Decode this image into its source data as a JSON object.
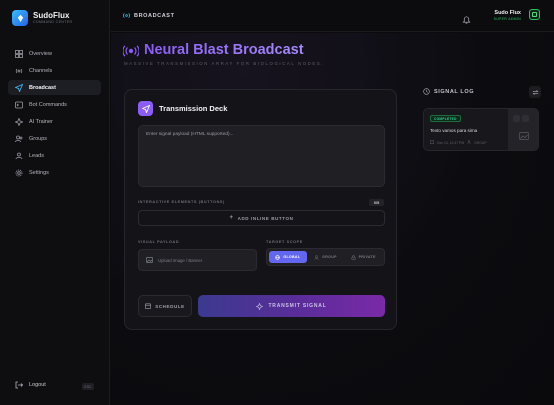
{
  "brand": {
    "name": "SudoFlux",
    "tagline": "COMMAND CENTER",
    "accent": "#3b82f6"
  },
  "sidebar": {
    "items": [
      {
        "label": "Overview",
        "icon": "grid-icon",
        "active": false
      },
      {
        "label": "Channels",
        "icon": "broadcast-signal-icon",
        "active": false
      },
      {
        "label": "Broadcast",
        "icon": "paper-plane-icon",
        "active": true
      },
      {
        "label": "Bot Commands",
        "icon": "terminal-icon",
        "active": false
      },
      {
        "label": "AI Trainer",
        "icon": "sparkle-icon",
        "active": false
      },
      {
        "label": "Groups",
        "icon": "users-icon",
        "active": false
      },
      {
        "label": "Leads",
        "icon": "user-group-icon",
        "active": false
      },
      {
        "label": "Settings",
        "icon": "gear-icon",
        "active": false
      }
    ],
    "logout_label": "Logout",
    "logout_badge": "ESC"
  },
  "header": {
    "title": "BROADCAST",
    "user_name": "Sudo Flux",
    "user_role": "SUPER ADMIN",
    "online_color": "#22c55e"
  },
  "page": {
    "title": "Neural Blast Broadcast",
    "subtitle": "MASSIVE TRANSMISSION ARRAY FOR BIOLOGICAL NODES.",
    "title_color": "#8b5cf6"
  },
  "deck": {
    "title": "Transmission Deck",
    "payload_placeholder": "Enter signal payload (HTML supported)...",
    "buttons_label": "INTERACTIVE ELEMENTS (BUTTONS)",
    "buttons_count": "0/5",
    "add_button_label": "ADD INLINE BUTTON",
    "visual_label": "VISUAL PAYLOAD",
    "upload_placeholder": "Upload Image / Banner",
    "scope_label": "TARGET SCOPE",
    "scope_options": [
      {
        "label": "GLOBAL",
        "active": true
      },
      {
        "label": "GROUP",
        "active": false
      },
      {
        "label": "PRIVATE",
        "active": false
      }
    ],
    "schedule_label": "SCHEDULE",
    "transmit_label": "TRANSMIT SIGNAL"
  },
  "signal_log": {
    "title": "SIGNAL LOG",
    "entries": [
      {
        "status": "COMPLETED",
        "text": "Texto vamos para sima",
        "date": "Dec 14, 12:47 PM",
        "target": "GROUP",
        "status_color": "#34d399"
      }
    ]
  }
}
